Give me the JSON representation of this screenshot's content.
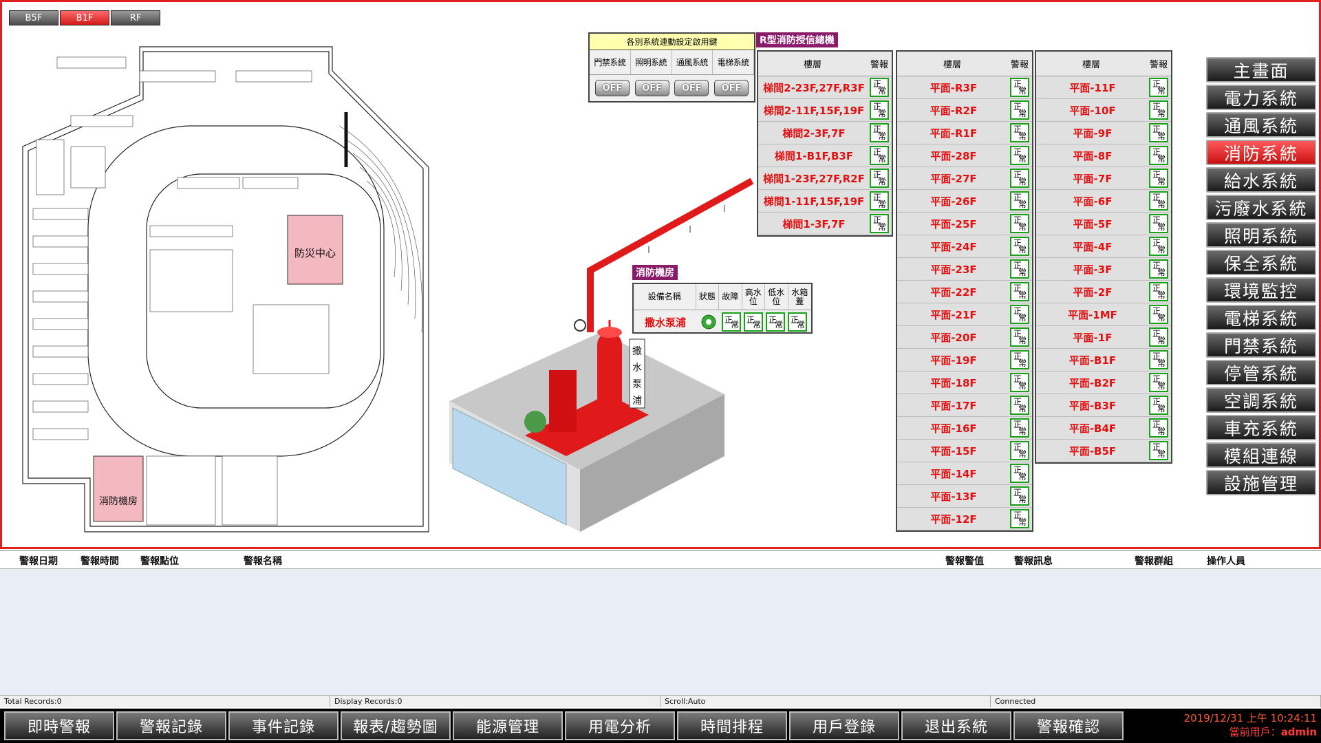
{
  "floor_tabs": [
    {
      "label": "B5F"
    },
    {
      "label": "B1F"
    },
    {
      "label": "RF"
    }
  ],
  "floorplan": {
    "room_disaster": "防災中心",
    "room_fire": "消防機房"
  },
  "link_panel": {
    "title": "各別系統連動設定啟用鍵",
    "columns": [
      "門禁系統",
      "照明系統",
      "通風系統",
      "電梯系統"
    ],
    "button_label": "OFF"
  },
  "r_panel": {
    "title": "R型消防授信總機",
    "col_floor": "樓層",
    "col_alarm": "警報",
    "status_top": "正",
    "status_bottom": "常",
    "table1": [
      "梯間2-23F,27F,R3F",
      "梯間2-11F,15F,19F",
      "梯間2-3F,7F",
      "梯間1-B1F,B3F",
      "梯間1-23F,27F,R2F",
      "梯間1-11F,15F,19F",
      "梯間1-3F,7F"
    ],
    "table2": [
      "平面-R3F",
      "平面-R2F",
      "平面-R1F",
      "平面-28F",
      "平面-27F",
      "平面-26F",
      "平面-25F",
      "平面-24F",
      "平面-23F",
      "平面-22F",
      "平面-21F",
      "平面-20F",
      "平面-19F",
      "平面-18F",
      "平面-17F",
      "平面-16F",
      "平面-15F",
      "平面-14F",
      "平面-13F",
      "平面-12F"
    ],
    "table3": [
      "平面-11F",
      "平面-10F",
      "平面-9F",
      "平面-8F",
      "平面-7F",
      "平面-6F",
      "平面-5F",
      "平面-4F",
      "平面-3F",
      "平面-2F",
      "平面-1MF",
      "平面-1F",
      "平面-B1F",
      "平面-B2F",
      "平面-B3F",
      "平面-B4F",
      "平面-B5F"
    ]
  },
  "equipment": {
    "title": "消防機房",
    "headers": [
      "設備名稱",
      "狀態",
      "故障",
      "高水位",
      "低水位",
      "水箱蓋"
    ],
    "name": "撒水泵浦",
    "status_top": "正",
    "status_bottom": "常"
  },
  "pump_label": "撒水泵浦",
  "side_nav": [
    {
      "label": "主畫面"
    },
    {
      "label": "電力系統"
    },
    {
      "label": "通風系統"
    },
    {
      "label": "消防系統"
    },
    {
      "label": "給水系統"
    },
    {
      "label": "污廢水系統"
    },
    {
      "label": "照明系統"
    },
    {
      "label": "保全系統"
    },
    {
      "label": "環境監控"
    },
    {
      "label": "電梯系統"
    },
    {
      "label": "門禁系統"
    },
    {
      "label": "停管系統"
    },
    {
      "label": "空調系統"
    },
    {
      "label": "車充系統"
    },
    {
      "label": "模組連線"
    },
    {
      "label": "設施管理"
    }
  ],
  "alarm_table": {
    "headers": [
      "警報日期",
      "警報時間",
      "警報點位",
      "警報名稱",
      "警報警值",
      "警報訊息",
      "警報群組",
      "操作人員"
    ]
  },
  "status_bar": {
    "total": "Total Records:0",
    "display": "Display Records:0",
    "scroll": "Scroll:Auto",
    "conn": "Connected"
  },
  "bottom_nav": [
    {
      "label": "即時警報"
    },
    {
      "label": "警報記錄"
    },
    {
      "label": "事件記錄"
    },
    {
      "label": "報表/趨勢圖"
    },
    {
      "label": "能源管理"
    },
    {
      "label": "用電分析"
    },
    {
      "label": "時間排程"
    },
    {
      "label": "用戶登錄"
    },
    {
      "label": "退出系統"
    },
    {
      "label": "警報確認"
    }
  ],
  "clock": {
    "datetime": "2019/12/31 上午 10:24:11",
    "user_label": "當前用戶：",
    "user": "admin"
  },
  "colors": {
    "accent_red": "#e02020",
    "status_green": "#18a018",
    "tag_purple": "#8a1a6a"
  }
}
